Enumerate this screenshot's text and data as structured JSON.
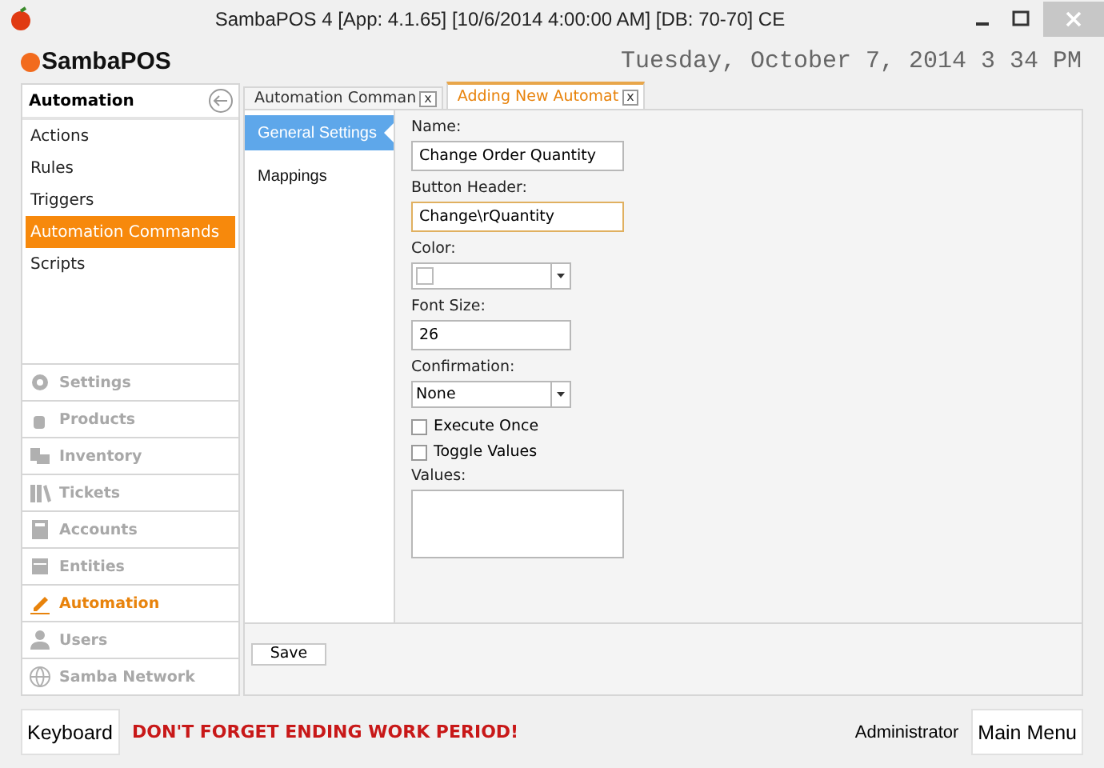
{
  "window": {
    "title": "SambaPOS 4 [App: 4.1.65] [10/6/2014 4:00:00 AM] [DB: 70-70] CE"
  },
  "header": {
    "logo": "SambaPOS",
    "date": "Tuesday, October 7, 2014 3 34 PM"
  },
  "sidebar": {
    "title": "Automation",
    "items": [
      {
        "label": "Actions",
        "selected": false
      },
      {
        "label": "Rules",
        "selected": false
      },
      {
        "label": "Triggers",
        "selected": false
      },
      {
        "label": "Automation Commands",
        "selected": true
      },
      {
        "label": "Scripts",
        "selected": false
      }
    ],
    "modules": [
      {
        "label": "Settings",
        "selected": false
      },
      {
        "label": "Products",
        "selected": false
      },
      {
        "label": "Inventory",
        "selected": false
      },
      {
        "label": "Tickets",
        "selected": false
      },
      {
        "label": "Accounts",
        "selected": false
      },
      {
        "label": "Entities",
        "selected": false
      },
      {
        "label": "Automation",
        "selected": true
      },
      {
        "label": "Users",
        "selected": false
      },
      {
        "label": "Samba Network",
        "selected": false
      }
    ]
  },
  "tabs": [
    {
      "label": "Automation Comman",
      "selected": false,
      "close": "x"
    },
    {
      "label": "Adding New Automat",
      "selected": true,
      "close": "x"
    }
  ],
  "sections": [
    {
      "label": "General Settings",
      "selected": true
    },
    {
      "label": "Mappings",
      "selected": false
    }
  ],
  "form": [
    {
      "kind": "text",
      "label": "Name:",
      "value": "Change Order Quantity",
      "focused": false,
      "wide": true
    },
    {
      "kind": "text",
      "label": "Button Header:",
      "value": "Change\\rQuantity",
      "focused": true,
      "wide": true
    },
    {
      "kind": "color",
      "label": "Color:"
    },
    {
      "kind": "text",
      "label": "Font Size:",
      "value": "26",
      "focused": false,
      "wide": false
    },
    {
      "kind": "select",
      "label": "Confirmation:",
      "value": "None"
    },
    {
      "kind": "check",
      "label": "Execute Once",
      "checked": false
    },
    {
      "kind": "check",
      "label": "Toggle Values",
      "checked": false
    },
    {
      "kind": "area",
      "label": "Values:"
    }
  ],
  "save_button": "Save",
  "footer": {
    "keyboard": "Keyboard",
    "warning": "DON'T FORGET ENDING WORK PERIOD!",
    "user": "Administrator",
    "main_menu": "Main Menu"
  }
}
